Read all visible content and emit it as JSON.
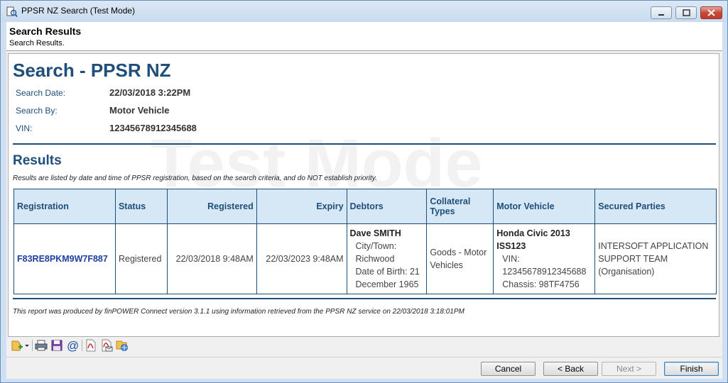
{
  "window": {
    "title": "PPSR NZ Search (Test Mode)"
  },
  "header": {
    "title": "Search Results",
    "subtitle": "Search Results."
  },
  "report": {
    "title": "Search - PPSR NZ",
    "watermark": "Test Mode",
    "criteria": [
      {
        "label": "Search Date:",
        "value": "22/03/2018 3:22PM"
      },
      {
        "label": "Search By:",
        "value": "Motor Vehicle"
      },
      {
        "label": "VIN:",
        "value": "12345678912345688"
      }
    ],
    "results_title": "Results",
    "results_note": "Results are listed by date and time of PPSR registration, based on the search criteria, and do NOT establish priority.",
    "columns": [
      "Registration",
      "Status",
      "Registered",
      "Expiry",
      "Debtors",
      "Collateral Types",
      "Motor Vehicle",
      "Secured Parties"
    ],
    "rows": [
      {
        "registration": "F83RE8PKM9W7F887",
        "status": "Registered",
        "registered": "22/03/2018 9:48AM",
        "expiry": "22/03/2023 9:48AM",
        "debtor_name": "Dave SMITH",
        "debtor_city": "City/Town: Richwood",
        "debtor_dob": "Date of Birth: 21 December 1965",
        "collateral": "Goods - Motor Vehicles",
        "vehicle_name": "Honda Civic 2013 ISS123",
        "vehicle_vin": "VIN: 12345678912345688",
        "vehicle_chassis": "Chassis: 98TF4756",
        "secured_party": "INTERSOFT APPLICATION SUPPORT TEAM (Organisation)"
      }
    ],
    "footer": "This report was produced by finPOWER Connect version 3.1.1 using information retrieved from the PPSR NZ service on 22/03/2018 3:18:01PM"
  },
  "toolbar": {
    "icons": [
      "new-document-icon",
      "dropdown-arrow-icon",
      "print-icon",
      "save-icon",
      "email-icon",
      "pdf-icon",
      "pdf-email-icon",
      "web-export-icon"
    ]
  },
  "buttons": {
    "cancel": "Cancel",
    "back": "< Back",
    "next": "Next >",
    "finish": "Finish"
  },
  "colors": {
    "accent": "#1f4e79",
    "header_bg": "#d6e8f5",
    "link": "#1f3fa0",
    "close_red": "#c8483a"
  }
}
